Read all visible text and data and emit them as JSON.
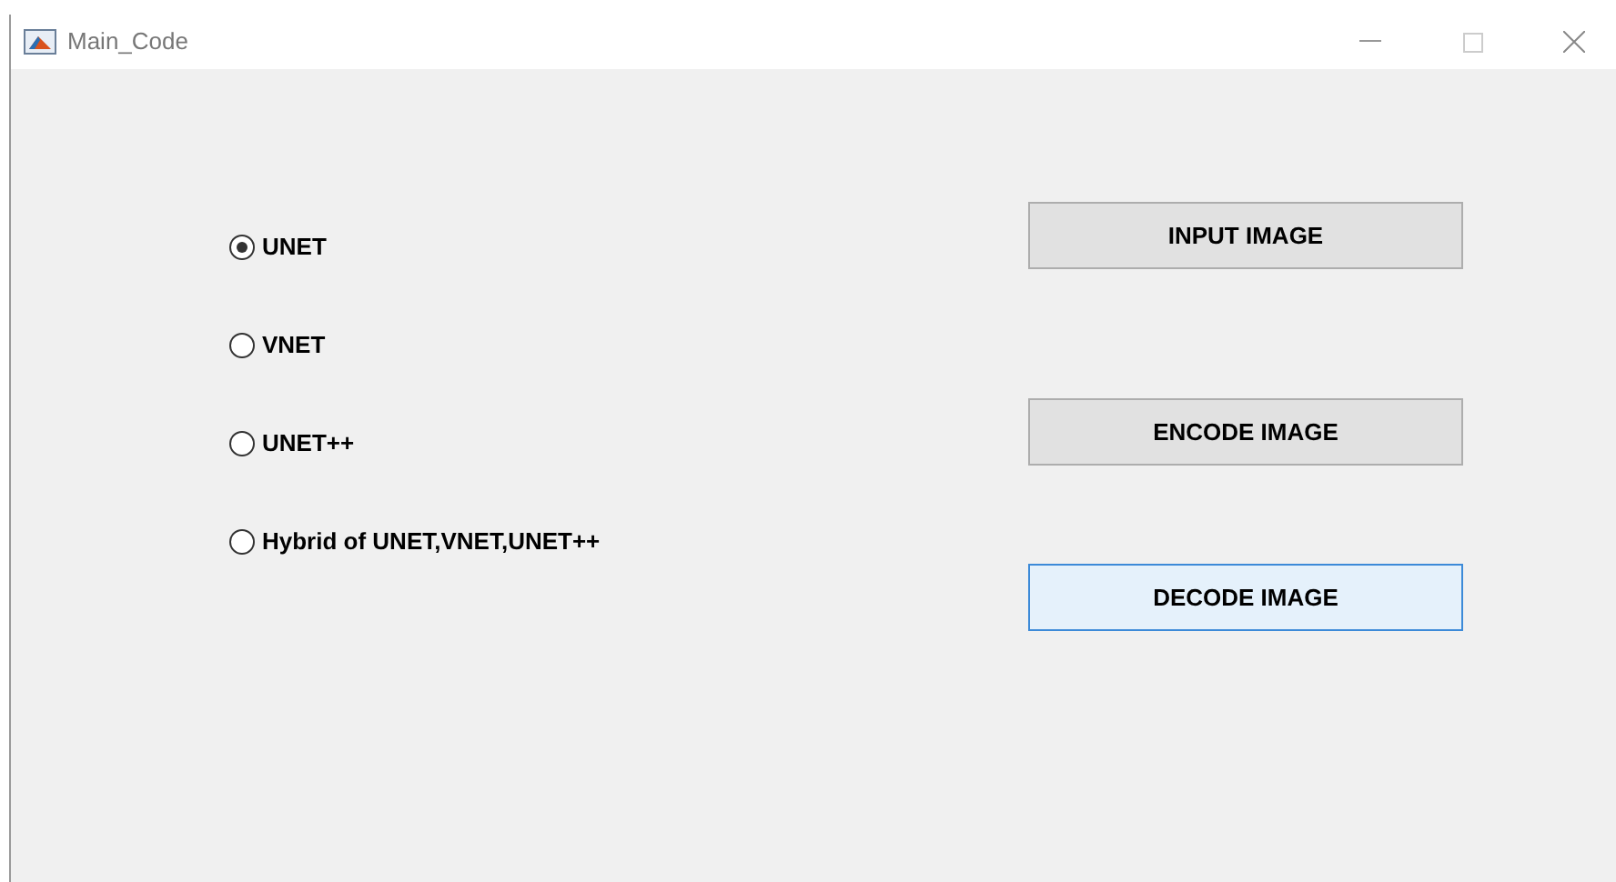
{
  "window": {
    "title": "Main_Code"
  },
  "options": [
    {
      "label": "UNET",
      "selected": true
    },
    {
      "label": "VNET",
      "selected": false
    },
    {
      "label": "UNET++",
      "selected": false
    },
    {
      "label": "Hybrid of UNET,VNET,UNET++",
      "selected": false
    }
  ],
  "buttons": [
    {
      "label": "INPUT IMAGE",
      "focused": false
    },
    {
      "label": "ENCODE IMAGE",
      "focused": false
    },
    {
      "label": "DECODE IMAGE",
      "focused": true
    }
  ]
}
